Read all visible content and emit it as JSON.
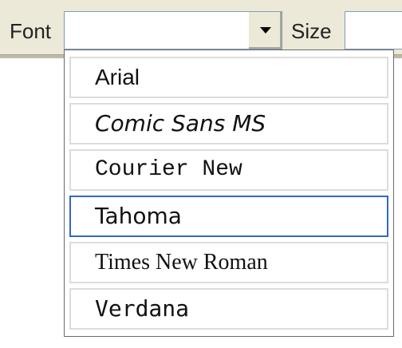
{
  "toolbar": {
    "font_label": "Font",
    "size_label": "Size",
    "font_value": "",
    "size_value": ""
  },
  "font_list": {
    "items": [
      {
        "label": "Arial",
        "selected": false
      },
      {
        "label": "Comic Sans MS",
        "selected": false
      },
      {
        "label": "Courier New",
        "selected": false
      },
      {
        "label": "Tahoma",
        "selected": true
      },
      {
        "label": "Times New Roman",
        "selected": false
      },
      {
        "label": "Verdana",
        "selected": false
      }
    ]
  },
  "icons": {
    "combo_arrow": "chevron-down-icon"
  },
  "colors": {
    "selection_border": "#316ac5",
    "toolbar_bg": "#ece9d8"
  }
}
